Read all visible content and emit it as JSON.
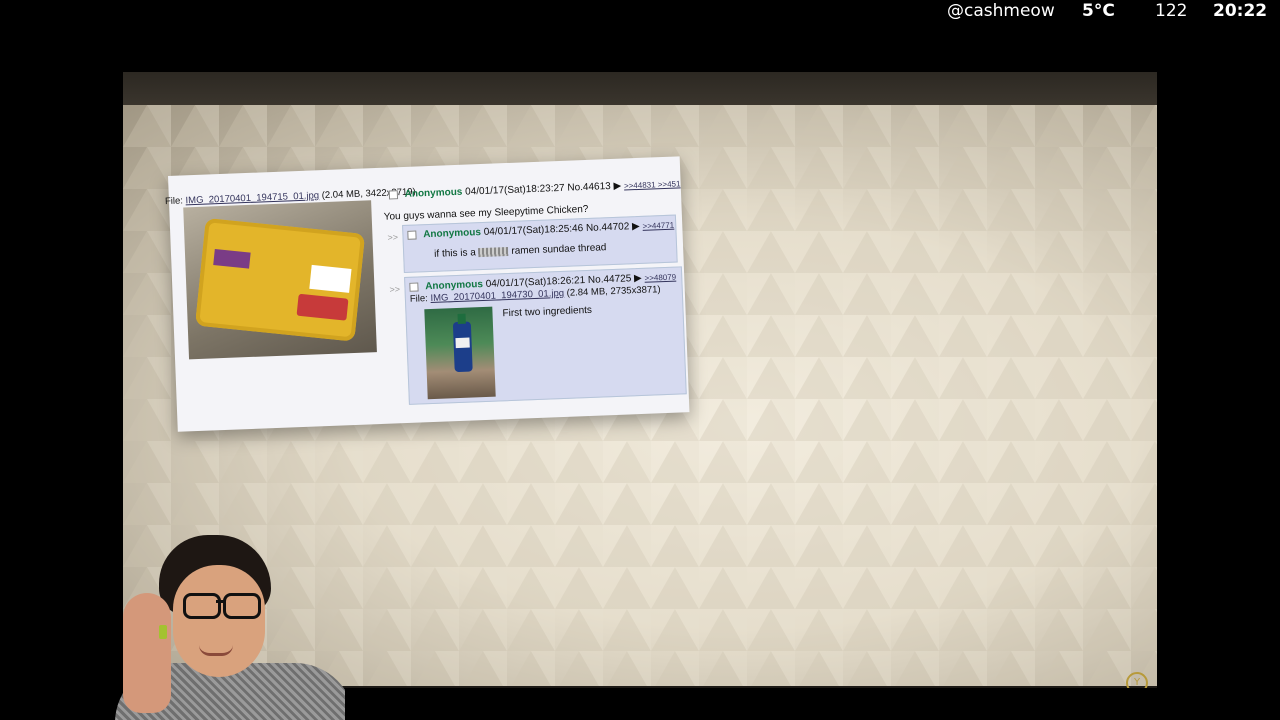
{
  "status_bar": {
    "username": "@cashmeow",
    "temperature": "5°C",
    "count": "122",
    "time": "20:22"
  },
  "thread": {
    "op": {
      "file_label": "File:",
      "file_name": "IMG_20170401_194715_01.jpg",
      "file_info": "(2.04 MB, 3422x2719)",
      "name": "Anonymous",
      "datetime": "04/01/17(Sat)18:23:27 No.44613",
      "marker": "▶",
      "quote_links": ">>44831 >>451",
      "body": "You guys wanna see my Sleepytime Chicken?"
    },
    "reply1": {
      "arrow": ">>",
      "name": "Anonymous",
      "datetime": "04/01/17(Sat)18:25:46 No.44702",
      "marker": "▶",
      "quote_links": ">>44771",
      "body_prefix": "if this is a",
      "body_suffix": "ramen sundae thread"
    },
    "reply2": {
      "arrow": ">>",
      "name": "Anonymous",
      "datetime": "04/01/17(Sat)18:26:21 No.44725",
      "marker": "▶",
      "quote_links": ">>48079",
      "file_label": "File:",
      "file_name": "IMG_20170401_194730_01.jpg",
      "file_info": "(2.84 MB, 2735x3871)",
      "body": "First two ingredients"
    }
  },
  "icons": {
    "corner_logo": "watermark-badge-icon",
    "corner_logo_glyph": "Y"
  },
  "colors": {
    "name_green": "#117743",
    "link": "#34345c",
    "reply_bg": "#d6daf0"
  }
}
